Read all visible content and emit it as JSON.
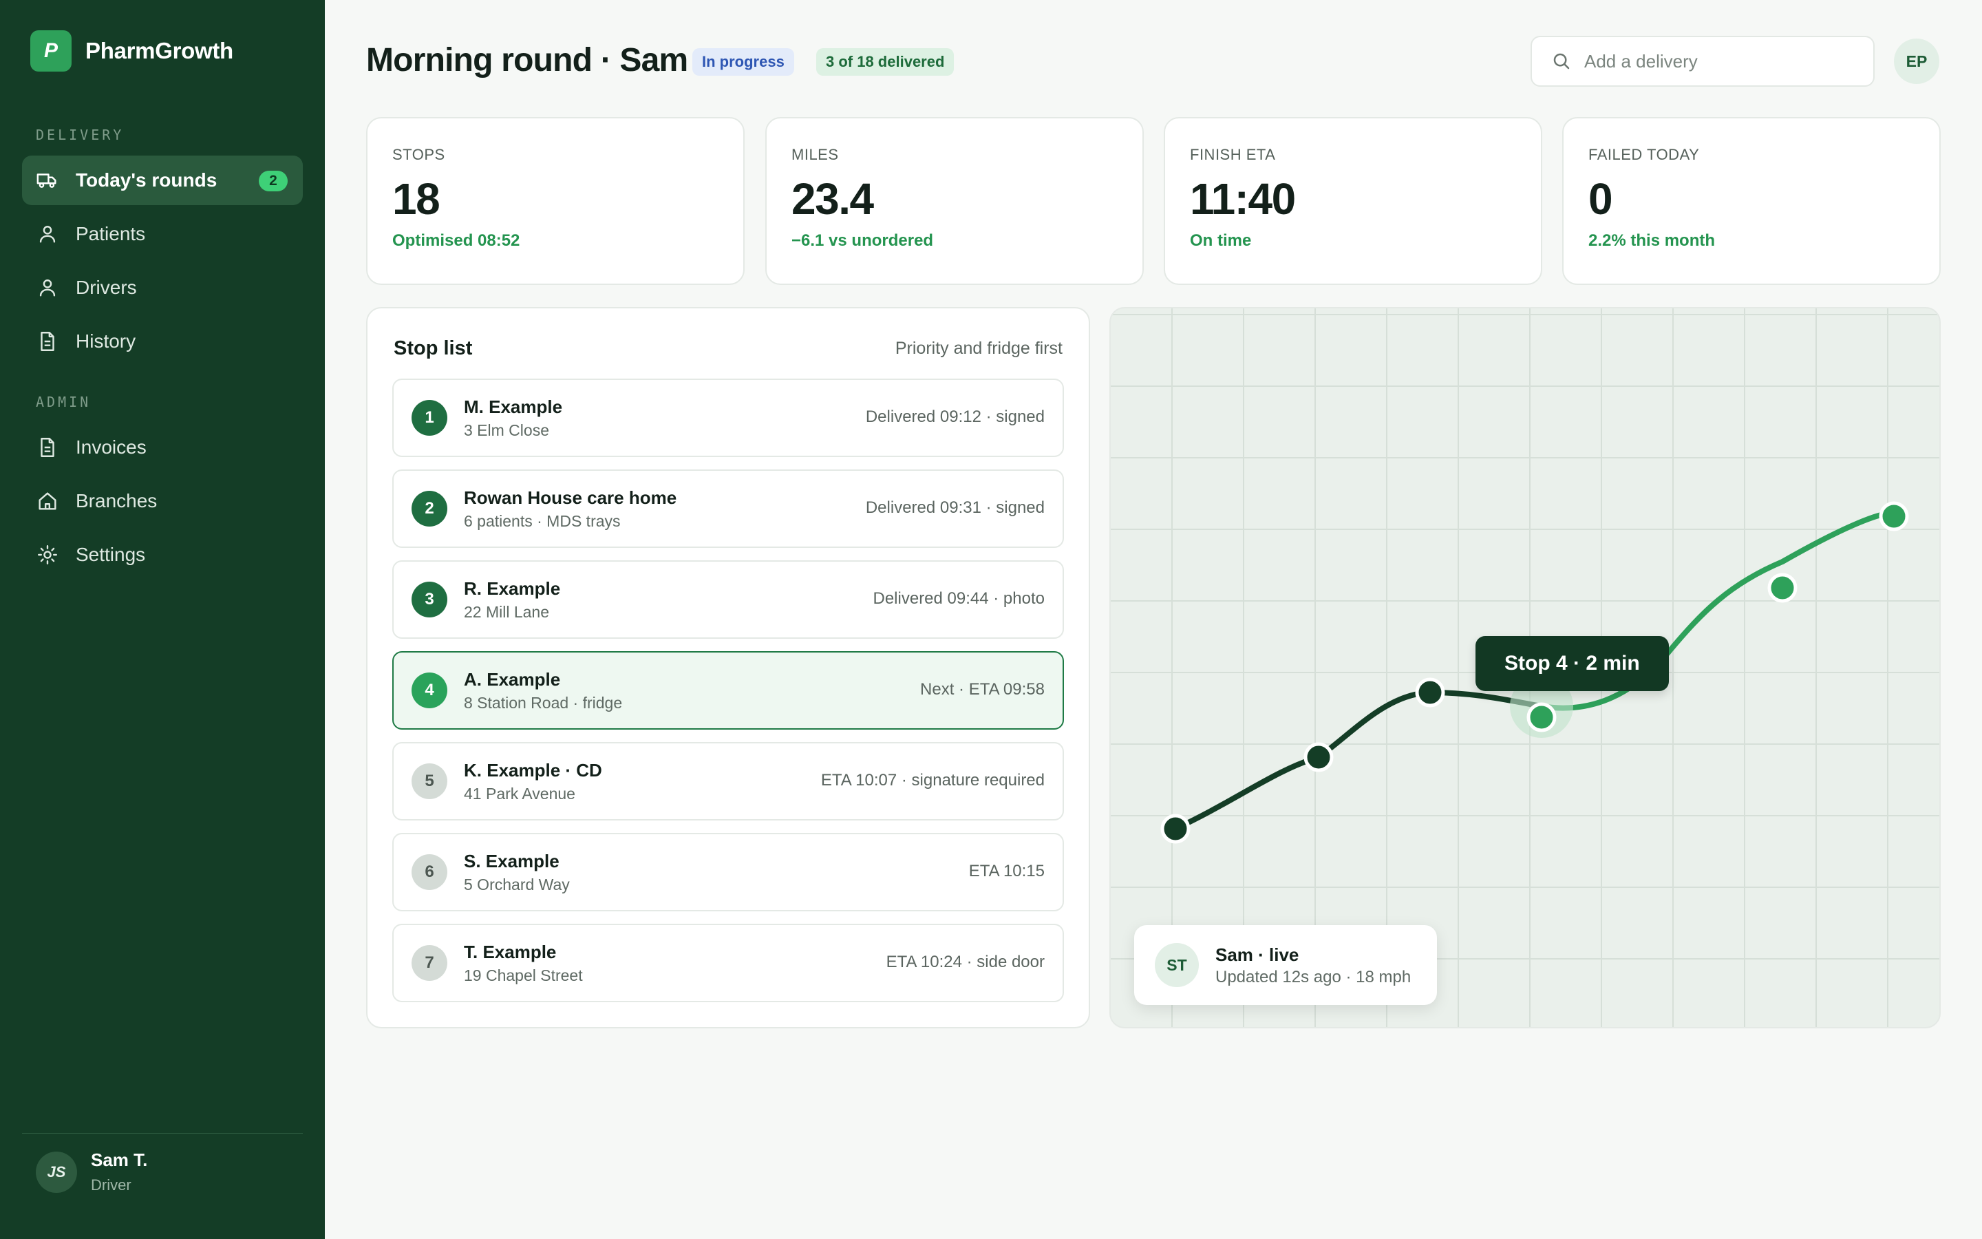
{
  "app": {
    "name": "PharmGrowth",
    "logo_letter": "P"
  },
  "sidebar": {
    "delivery_label": "DELIVERY",
    "admin_label": "ADMIN",
    "items": [
      {
        "label": "Today's rounds",
        "icon": "truck-icon",
        "badge": "2",
        "active": true
      },
      {
        "label": "Patients",
        "icon": "user-icon"
      },
      {
        "label": "Drivers",
        "icon": "user-icon"
      },
      {
        "label": "History",
        "icon": "document-icon"
      },
      {
        "label": "Invoices",
        "icon": "document-icon"
      },
      {
        "label": "Branches",
        "icon": "home-icon"
      },
      {
        "label": "Settings",
        "icon": "gear-icon"
      }
    ],
    "user": {
      "initials": "JS",
      "name": "Sam T.",
      "role": "Driver"
    }
  },
  "header": {
    "title": "Morning round · Sam",
    "status_pill": "In progress",
    "progress_pill": "3 of 18 delivered",
    "search_placeholder": "Add a delivery",
    "avatar_initials": "EP"
  },
  "stats": [
    {
      "label": "STOPS",
      "value": "18",
      "sub": "Optimised 08:52"
    },
    {
      "label": "MILES",
      "value": "23.4",
      "sub": "−6.1 vs unordered"
    },
    {
      "label": "FINISH ETA",
      "value": "11:40",
      "sub": "On time"
    },
    {
      "label": "FAILED TODAY",
      "value": "0",
      "sub": "2.2% this month"
    }
  ],
  "stop_list": {
    "title": "Stop list",
    "hint": "Priority and fridge first",
    "stops": [
      {
        "num": "1",
        "name": "M. Example",
        "address": "3 Elm Close",
        "status": "Delivered 09:12 · signed",
        "state": "done"
      },
      {
        "num": "2",
        "name": "Rowan House care home",
        "address": "6 patients · MDS trays",
        "status": "Delivered 09:31 · signed",
        "state": "done"
      },
      {
        "num": "3",
        "name": "R. Example",
        "address": "22 Mill Lane",
        "status": "Delivered 09:44 · photo",
        "state": "done"
      },
      {
        "num": "4",
        "name": "A. Example",
        "address": "8 Station Road · fridge",
        "status": "Next · ETA 09:58",
        "state": "current"
      },
      {
        "num": "5",
        "name": "K. Example · CD",
        "address": "41 Park Avenue",
        "status": "ETA 10:07 · signature required",
        "state": "pending"
      },
      {
        "num": "6",
        "name": "S. Example",
        "address": "5 Orchard Way",
        "status": "ETA 10:15",
        "state": "pending"
      },
      {
        "num": "7",
        "name": "T. Example",
        "address": "19 Chapel Street",
        "status": "ETA 10:24 · side door",
        "state": "pending"
      }
    ]
  },
  "map": {
    "tooltip": "Stop 4 · 2 min",
    "driver": {
      "initials": "ST",
      "name": "Sam · live",
      "meta": "Updated 12s ago · 18 mph"
    },
    "colors": {
      "done_route": "#143d26",
      "pending_route": "#2ea15a",
      "current_halo": "#bfe2cb"
    }
  }
}
